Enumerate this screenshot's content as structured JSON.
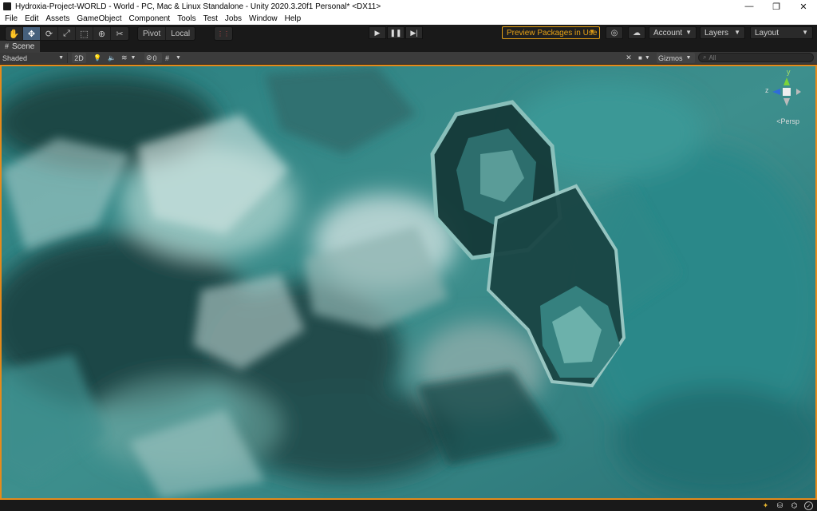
{
  "window": {
    "title": "Hydroxia-Project-WORLD - World - PC, Mac & Linux Standalone - Unity 2020.3.20f1 Personal* <DX11>",
    "minimize_glyph": "—",
    "maximize_glyph": "❐",
    "close_glyph": "✕"
  },
  "menu": [
    "File",
    "Edit",
    "Assets",
    "GameObject",
    "Component",
    "Tools",
    "Test",
    "Jobs",
    "Window",
    "Help"
  ],
  "toolbar": {
    "tools": [
      {
        "name": "hand-tool-icon",
        "glyph": "✋"
      },
      {
        "name": "move-tool-icon",
        "glyph": "✥"
      },
      {
        "name": "rotate-tool-icon",
        "glyph": "⟳"
      },
      {
        "name": "scale-tool-icon",
        "glyph": "⤢"
      },
      {
        "name": "rect-tool-icon",
        "glyph": "⬚"
      },
      {
        "name": "transform-tool-icon",
        "glyph": "⊕"
      },
      {
        "name": "custom-tool-icon",
        "glyph": "✂"
      }
    ],
    "pivot_label": "Pivot",
    "local_label": "Local",
    "grid_snap_glyph": "⋮⋮",
    "play_glyph": "▶",
    "pause_glyph": "❚❚",
    "step_glyph": "▶|",
    "preview_packages_label": "Preview Packages in Use",
    "collab_glyph": "◎",
    "cloud_glyph": "☁",
    "account_label": "Account",
    "layers_label": "Layers",
    "layout_label": "Layout",
    "dropdown_glyph": "▼"
  },
  "scene_tab": {
    "label": "Scene",
    "icon_glyph": "#"
  },
  "scene_toolbar": {
    "shading_mode": "Shaded",
    "mode_2d": "2D",
    "light_glyph": "💡",
    "audio_glyph": "🔈",
    "effects_glyph": "≋",
    "hidden_glyph": "⊘",
    "hidden_count": "0",
    "grid_glyph": "#",
    "tools_glyph": "✕",
    "camera_glyph": "■",
    "gizmos_label": "Gizmos",
    "search_placeholder": "All"
  },
  "scene_view": {
    "projection_label": "Persp",
    "axis_y": "y",
    "axis_z": "z",
    "accent_colors": {
      "teal": "#2f8a8c",
      "highlight": "#bfe4e0",
      "shadow": "#1c3f40",
      "border": "#e58b1b"
    }
  },
  "statusbar": {
    "icons": [
      {
        "name": "lighting-icon",
        "glyph": "✦"
      },
      {
        "name": "collab-status-icon",
        "glyph": "⛁"
      },
      {
        "name": "cache-server-icon",
        "glyph": "⌬"
      },
      {
        "name": "check-status-icon",
        "glyph": "✓"
      }
    ]
  }
}
